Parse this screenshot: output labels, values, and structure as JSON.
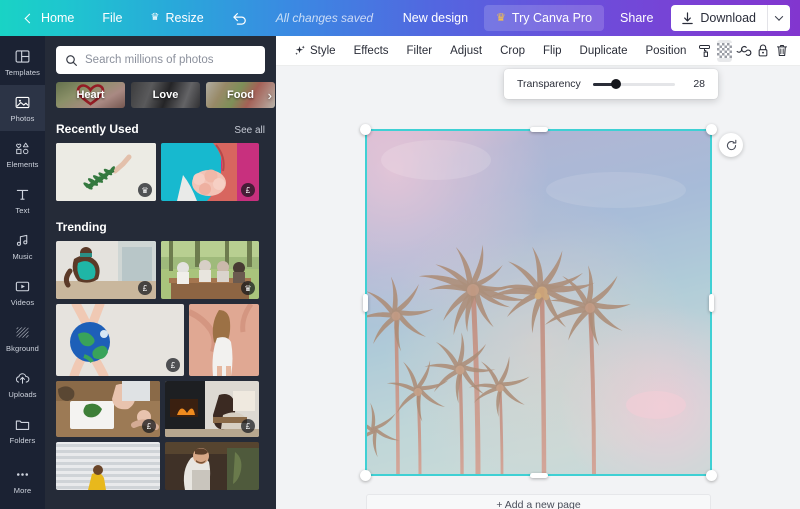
{
  "topbar": {
    "home": "Home",
    "file": "File",
    "resize": "Resize",
    "status": "All changes saved",
    "new_design": "New design",
    "try_pro": "Try Canva Pro",
    "share": "Share",
    "download": "Download",
    "gradient_from": "#19d3c5",
    "gradient_to": "#8236cf"
  },
  "rail": {
    "items": [
      {
        "label": "Templates",
        "icon": "templates-icon"
      },
      {
        "label": "Photos",
        "icon": "photos-icon"
      },
      {
        "label": "Elements",
        "icon": "elements-icon"
      },
      {
        "label": "Text",
        "icon": "text-icon"
      },
      {
        "label": "Music",
        "icon": "music-icon"
      },
      {
        "label": "Videos",
        "icon": "videos-icon"
      },
      {
        "label": "Bkground",
        "icon": "background-icon"
      },
      {
        "label": "Uploads",
        "icon": "uploads-icon"
      },
      {
        "label": "Folders",
        "icon": "folders-icon"
      },
      {
        "label": "More",
        "icon": "more-icon"
      }
    ],
    "active": "Photos"
  },
  "panel": {
    "search": {
      "placeholder": "Search millions of photos",
      "value": ""
    },
    "chips": [
      {
        "label": "Heart"
      },
      {
        "label": "Love"
      },
      {
        "label": "Food"
      }
    ],
    "sections": [
      {
        "title": "Recently Used",
        "link": "See all"
      },
      {
        "title": "Trending",
        "link": ""
      }
    ],
    "badges": {
      "pro": "♛",
      "paid": "£"
    }
  },
  "toolbar": {
    "style": "Style",
    "effects": "Effects",
    "filter": "Filter",
    "adjust": "Adjust",
    "crop": "Crop",
    "flip": "Flip",
    "duplicate": "Duplicate",
    "position": "Position",
    "icons": [
      {
        "name": "paint-roller-icon",
        "active": false
      },
      {
        "name": "transparency-icon",
        "active": true
      },
      {
        "name": "copy-style-icon",
        "active": false
      },
      {
        "name": "lock-icon",
        "active": false
      },
      {
        "name": "delete-icon",
        "active": false
      }
    ]
  },
  "transparency": {
    "label": "Transparency",
    "value": 28,
    "min": 0,
    "max": 100
  },
  "canvas": {
    "add_page": "+ Add a new page",
    "selection_color": "#3fd0d4",
    "image_alt": "palm-trees-photo"
  }
}
